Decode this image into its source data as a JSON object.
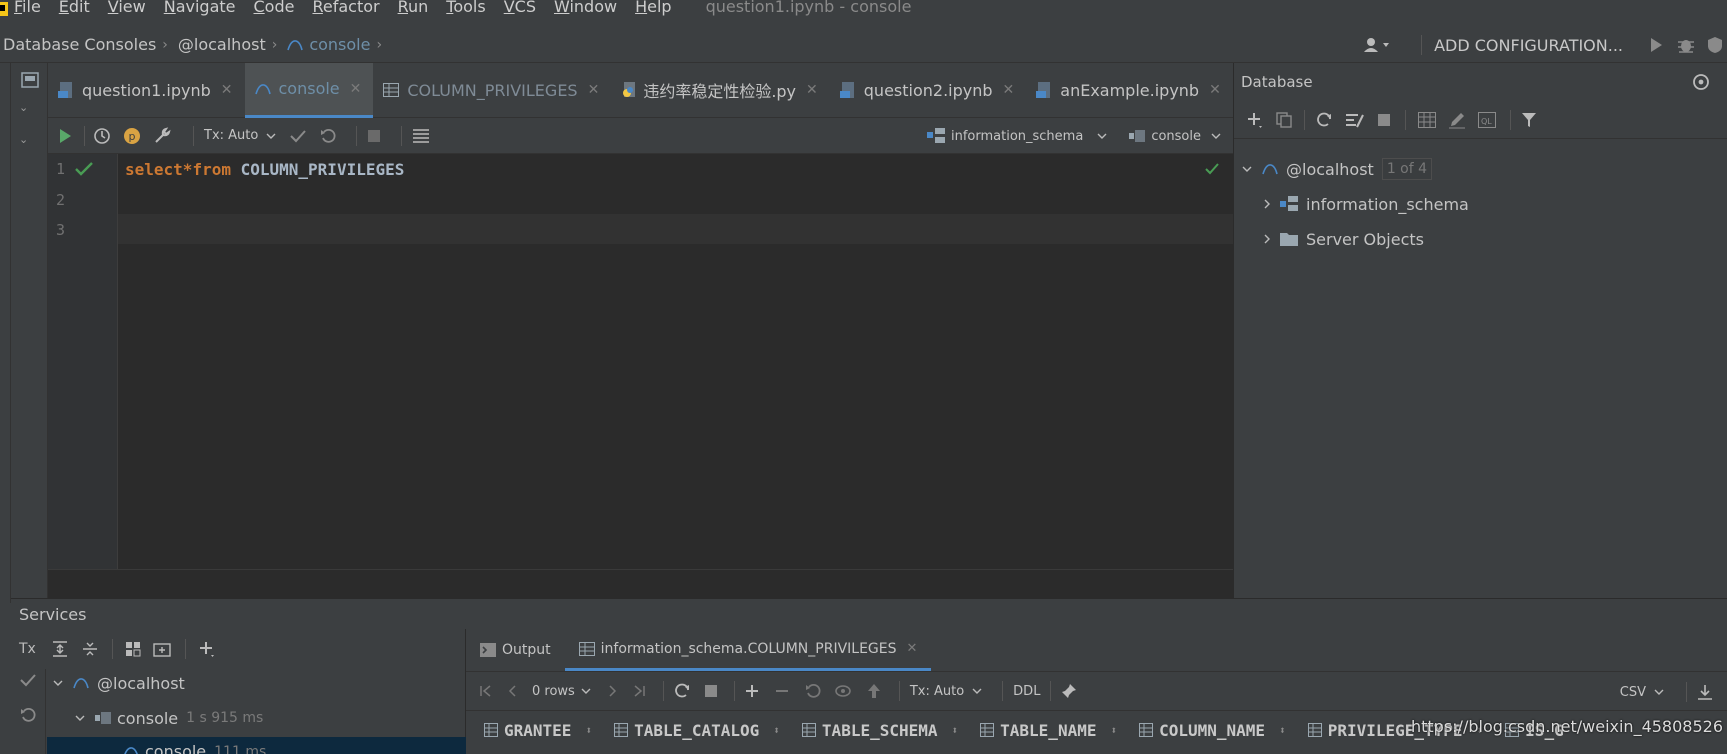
{
  "menubar": {
    "items": [
      "File",
      "Edit",
      "View",
      "Navigate",
      "Code",
      "Refactor",
      "Run",
      "Tools",
      "VCS",
      "Window",
      "Help"
    ],
    "window_title": "question1.ipynb - console"
  },
  "navbar": {
    "breadcrumbs": [
      "Database Consoles",
      "@localhost",
      "console"
    ],
    "add_configuration": "ADD CONFIGURATION..."
  },
  "tabs": [
    {
      "label": "question1.ipynb",
      "icon": "notebook-icon",
      "active": false
    },
    {
      "label": "console",
      "icon": "mysql-icon",
      "active": true
    },
    {
      "label": "COLUMN_PRIVILEGES",
      "icon": "table-icon",
      "active": false
    },
    {
      "label": "违约率稳定性检验.py",
      "icon": "python-icon",
      "active": false
    },
    {
      "label": "question2.ipynb",
      "icon": "notebook-icon",
      "active": false
    },
    {
      "label": "anExample.ipynb",
      "icon": "notebook-icon",
      "active": false
    }
  ],
  "editor_toolbar": {
    "tx_mode": "Tx: Auto",
    "schema": "information_schema",
    "session": "console"
  },
  "editor": {
    "line_numbers": [
      "1",
      "2",
      "3"
    ],
    "code_kw1": "select",
    "code_op": "*",
    "code_kw2": "from",
    "code_ident": "COLUMN_PRIVILEGES"
  },
  "database_panel": {
    "title": "Database",
    "tree": {
      "root": "@localhost",
      "root_badge": "1 of 4",
      "children": [
        "information_schema",
        "Server Objects"
      ]
    }
  },
  "services": {
    "title": "Services",
    "tx_label": "Tx",
    "tree": {
      "root": "@localhost",
      "console": "console",
      "console_time": "1 s 915 ms",
      "sub_console": "console",
      "sub_time": "111 ms"
    },
    "tabs": [
      "Output",
      "information_schema.COLUMN_PRIVILEGES"
    ],
    "result_toolbar": {
      "rows": "0 rows",
      "tx_mode": "Tx: Auto",
      "ddl": "DDL",
      "export_format": "CSV"
    },
    "columns": [
      "GRANTEE",
      "TABLE_CATALOG",
      "TABLE_SCHEMA",
      "TABLE_NAME",
      "COLUMN_NAME",
      "PRIVILEGE_TYPE",
      "IS_G"
    ],
    "watermark": "https://blog.csdn.net/weixin_45808526"
  },
  "colors": {
    "accent": "#4a88c7",
    "keyword": "#cc7832",
    "success": "#499c54",
    "run": "#59a869"
  }
}
